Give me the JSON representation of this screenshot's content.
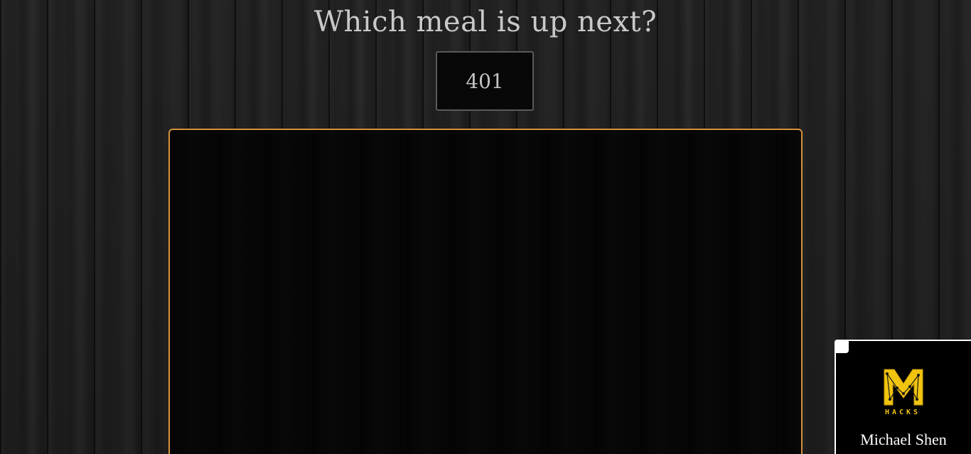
{
  "header": {
    "title": "Which meal is up next?"
  },
  "counter": {
    "value": "401"
  },
  "badge": {
    "logo_icon": "m-hacks-logo-icon",
    "logo_text": "HACKS",
    "name": "Michael Shen",
    "accent_color": "#f1c40f"
  },
  "colors": {
    "panel_border": "#d6913a",
    "background": "#1c1c1c"
  }
}
